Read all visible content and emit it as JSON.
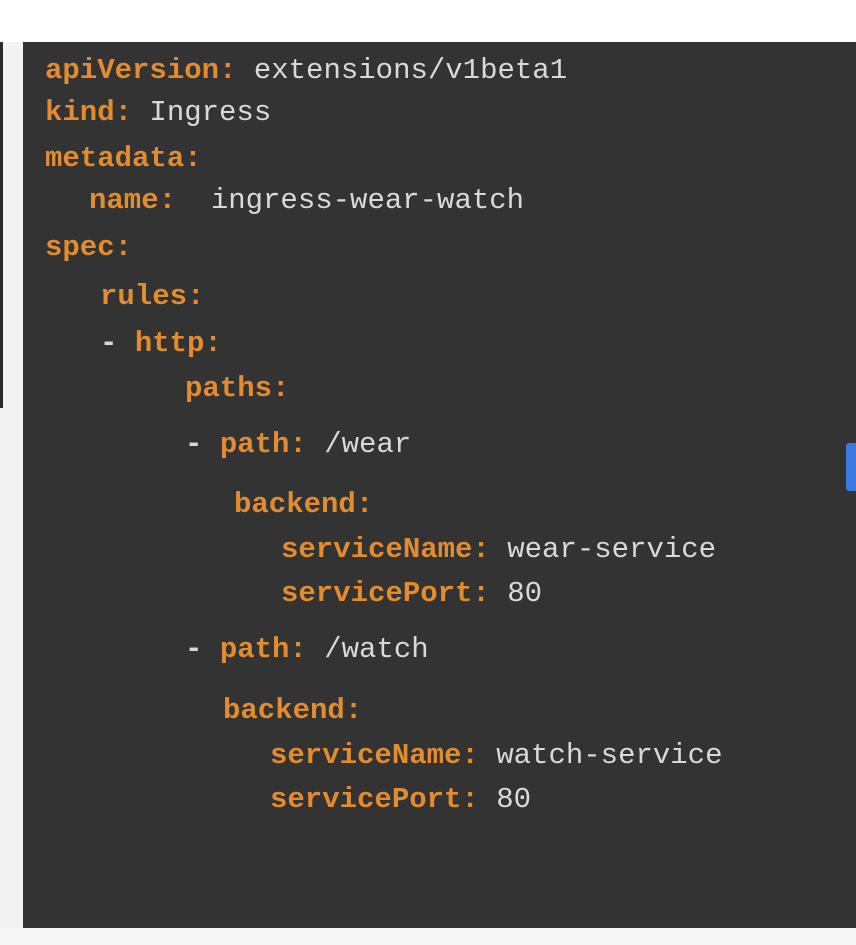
{
  "code_editor": {
    "lines": [
      {
        "prefix": "",
        "key": "apiVersion:",
        "value": " extensions/v1beta1"
      },
      {
        "prefix": "",
        "key": "kind:",
        "value": " Ingress"
      },
      {
        "prefix": "",
        "key": "metadata:",
        "value": ""
      },
      {
        "prefix": "",
        "key": "name:",
        "value": "  ingress-wear-watch"
      },
      {
        "prefix": "",
        "key": "spec:",
        "value": ""
      },
      {
        "prefix": "",
        "key": "rules:",
        "value": ""
      },
      {
        "prefix": "- ",
        "key": "http:",
        "value": ""
      },
      {
        "prefix": "",
        "key": "paths:",
        "value": ""
      },
      {
        "prefix": "- ",
        "key": "path:",
        "value": " /wear"
      },
      {
        "prefix": "",
        "key": "backend:",
        "value": ""
      },
      {
        "prefix": "",
        "key": "serviceName:",
        "value": " wear-service"
      },
      {
        "prefix": "",
        "key": "servicePort:",
        "value": " 80"
      },
      {
        "prefix": "- ",
        "key": "path:",
        "value": " /watch"
      },
      {
        "prefix": "",
        "key": "backend:",
        "value": ""
      },
      {
        "prefix": "",
        "key": "serviceName:",
        "value": " watch-service"
      },
      {
        "prefix": "",
        "key": "servicePort:",
        "value": " 80"
      }
    ]
  },
  "colors": {
    "background": "#333333",
    "key": "#e38c2f",
    "value": "#d9d9d9",
    "accent_marker": "#3b78e0"
  }
}
